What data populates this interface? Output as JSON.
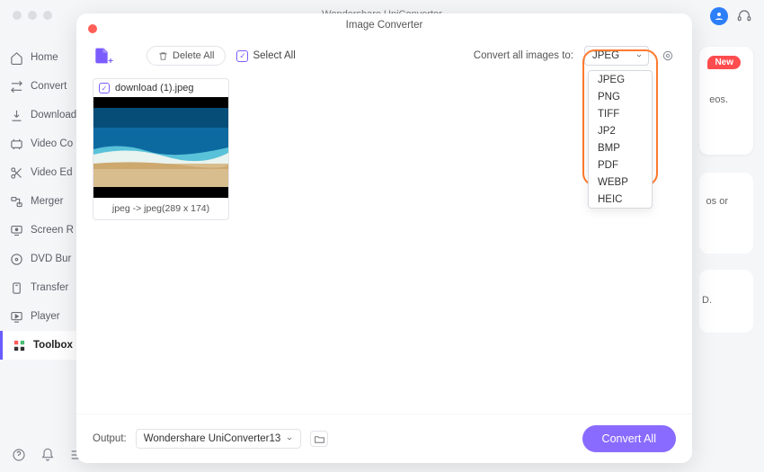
{
  "sidebar": {
    "items": [
      {
        "label": "Home",
        "icon": "home"
      },
      {
        "label": "Convert",
        "icon": "convert"
      },
      {
        "label": "Download",
        "icon": "download"
      },
      {
        "label": "Video Co",
        "icon": "video"
      },
      {
        "label": "Video Ed",
        "icon": "scissors"
      },
      {
        "label": "Merger",
        "icon": "merge"
      },
      {
        "label": "Screen R",
        "icon": "screen"
      },
      {
        "label": "DVD Bur",
        "icon": "dvd"
      },
      {
        "label": "Transfer",
        "icon": "transfer"
      },
      {
        "label": "Player",
        "icon": "player"
      },
      {
        "label": "Toolbox",
        "icon": "grid"
      }
    ],
    "active_index": 10
  },
  "background": {
    "new_badge": "New",
    "text1": "eos.",
    "text2": "os or",
    "text3": "D."
  },
  "modal": {
    "app_title_line1": "Wondershare UniConvertor",
    "title": "Image Converter",
    "toolbar": {
      "delete_all": "Delete All",
      "select_all": "Select All",
      "convert_label": "Convert all images to:",
      "format_selected": "JPEG",
      "format_options": [
        "JPEG",
        "PNG",
        "TIFF",
        "JP2",
        "BMP",
        "PDF",
        "WEBP",
        "HEIC"
      ]
    },
    "card": {
      "filename": "download (1).jpeg",
      "footer": "jpeg -> jpeg(289 x 174)"
    },
    "footer": {
      "output_label": "Output:",
      "output_path": "Wondershare UniConverter13",
      "convert_button": "Convert All"
    }
  }
}
